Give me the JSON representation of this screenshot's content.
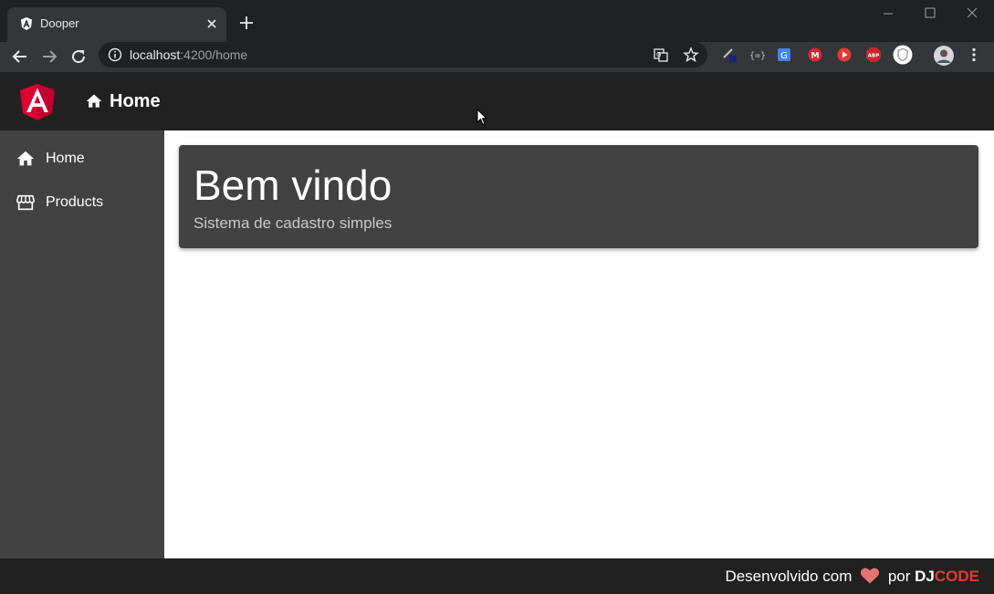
{
  "browser": {
    "tab_title": "Dooper",
    "url_host": "localhost",
    "url_path": ":4200/home"
  },
  "app": {
    "header_title": "Home",
    "nav": [
      {
        "label": "Home",
        "icon": "home-icon"
      },
      {
        "label": "Products",
        "icon": "storefront-icon"
      }
    ],
    "card": {
      "title": "Bem vindo",
      "subtitle": "Sistema de cadastro simples"
    },
    "footer": {
      "text": "Desenvolvido com",
      "by": "por",
      "brand_dj": "DJ",
      "brand_code": "CODE"
    }
  },
  "colors": {
    "brand_code": "#e53935",
    "heart": "#e57373",
    "angular_red": "#dd0031",
    "sidenav": "#424242",
    "header": "#212121"
  }
}
